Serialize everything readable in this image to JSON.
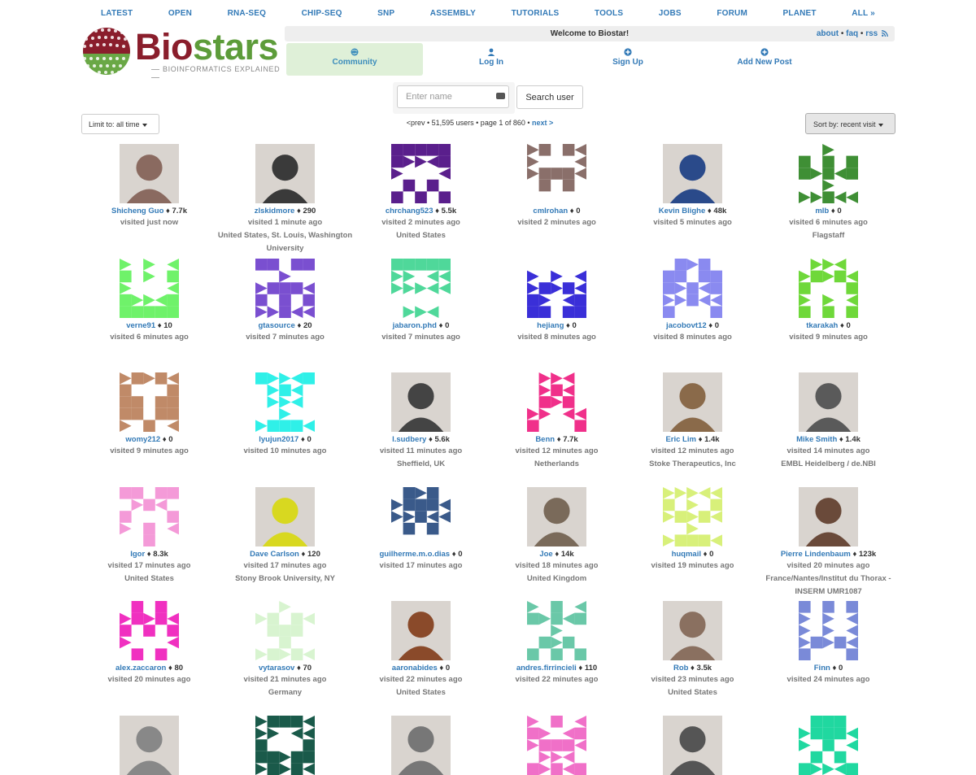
{
  "nav": [
    "LATEST",
    "OPEN",
    "RNA-SEQ",
    "CHIP-SEQ",
    "SNP",
    "ASSEMBLY",
    "TUTORIALS",
    "TOOLS",
    "JOBS",
    "FORUM",
    "PLANET",
    "ALL »"
  ],
  "logo": {
    "word1": "Bio",
    "word2": "stars",
    "tagline": "BIOINFORMATICS EXPLAINED"
  },
  "welcome": {
    "text": "Welcome to Biostar!",
    "about": "about",
    "faq": "faq",
    "rss": "rss",
    "sep": "•"
  },
  "menu": [
    {
      "label": "Community",
      "icon": "globe-icon"
    },
    {
      "label": "Log In",
      "icon": "user-icon"
    },
    {
      "label": "Sign Up",
      "icon": "plus-icon"
    },
    {
      "label": "Add New Post",
      "icon": "plus-icon"
    }
  ],
  "search": {
    "placeholder": "Enter name",
    "button": "Search user"
  },
  "limit": "Limit to: all time",
  "sort": "Sort by: recent visit",
  "pager": {
    "prev": "<prev",
    "summary": "• 51,595 users • page 1 of 860 •",
    "next": "next >"
  },
  "colors": {
    "link": "#337ab7",
    "active_tab_bg": "#dff0d8",
    "logo_red": "#8a1e2c",
    "logo_green": "#5d9c3a"
  },
  "users": [
    {
      "name": "Shicheng Guo",
      "rep": "7.7k",
      "visited": "visited just now",
      "loc": "",
      "color": "#8a6a60",
      "photo": true
    },
    {
      "name": "zlskidmore",
      "rep": "290",
      "visited": "visited 1 minute ago",
      "loc": "United States, St. Louis, Washington University",
      "color": "#3a3a3a",
      "photo": true
    },
    {
      "name": "chrchang523",
      "rep": "5.5k",
      "visited": "visited 2 minutes ago",
      "loc": "United States",
      "color": "#5a1f8c",
      "photo": false
    },
    {
      "name": "cmlrohan",
      "rep": "0",
      "visited": "visited 2 minutes ago",
      "loc": "",
      "color": "#8a6f6a",
      "photo": false
    },
    {
      "name": "Kevin Blighe",
      "rep": "48k",
      "visited": "visited 5 minutes ago",
      "loc": "",
      "color": "#2a4a8a",
      "photo": true
    },
    {
      "name": "mlb",
      "rep": "0",
      "visited": "visited 6 minutes ago",
      "loc": "Flagstaff",
      "color": "#3f8f35",
      "photo": false
    },
    {
      "name": "verne91",
      "rep": "10",
      "visited": "visited 6 minutes ago",
      "loc": "",
      "color": "#6ff26a",
      "photo": false
    },
    {
      "name": "gtasource",
      "rep": "20",
      "visited": "visited 7 minutes ago",
      "loc": "",
      "color": "#7a4fd0",
      "photo": false
    },
    {
      "name": "jabaron.phd",
      "rep": "0",
      "visited": "visited 7 minutes ago",
      "loc": "",
      "color": "#4fd89a",
      "photo": false
    },
    {
      "name": "hejiang",
      "rep": "0",
      "visited": "visited 8 minutes ago",
      "loc": "",
      "color": "#3a2fd8",
      "photo": false
    },
    {
      "name": "jacobovt12",
      "rep": "0",
      "visited": "visited 8 minutes ago",
      "loc": "",
      "color": "#8a8af0",
      "photo": false
    },
    {
      "name": "tkarakah",
      "rep": "0",
      "visited": "visited 9 minutes ago",
      "loc": "",
      "color": "#6fd83a",
      "photo": false
    },
    {
      "name": "womy212",
      "rep": "0",
      "visited": "visited 9 minutes ago",
      "loc": "",
      "color": "#c08a68",
      "photo": false
    },
    {
      "name": "lyujun2017",
      "rep": "0",
      "visited": "visited 10 minutes ago",
      "loc": "",
      "color": "#2ff0e8",
      "photo": false
    },
    {
      "name": "l.sudbery",
      "rep": "5.6k",
      "visited": "visited 11 minutes ago",
      "loc": "Sheffield, UK",
      "color": "#444444",
      "photo": true
    },
    {
      "name": "Benn",
      "rep": "7.7k",
      "visited": "visited 12 minutes ago",
      "loc": "Netherlands",
      "color": "#f0308a",
      "photo": false
    },
    {
      "name": "Eric Lim",
      "rep": "1.4k",
      "visited": "visited 12 minutes ago",
      "loc": "Stoke Therapeutics, Inc",
      "color": "#8a6a4a",
      "photo": true
    },
    {
      "name": "Mike Smith",
      "rep": "1.4k",
      "visited": "visited 14 minutes ago",
      "loc": "EMBL Heidelberg / de.NBI",
      "color": "#5a5a5a",
      "photo": true
    },
    {
      "name": "Igor",
      "rep": "8.3k",
      "visited": "visited 17 minutes ago",
      "loc": "United States",
      "color": "#f49ad8",
      "photo": false
    },
    {
      "name": "Dave Carlson",
      "rep": "120",
      "visited": "visited 17 minutes ago",
      "loc": "Stony Brook University, NY",
      "color": "#d8d820",
      "photo": true
    },
    {
      "name": "guilherme.m.o.dias",
      "rep": "0",
      "visited": "visited 17 minutes ago",
      "loc": "",
      "color": "#3a5a8a",
      "photo": false
    },
    {
      "name": "Joe",
      "rep": "14k",
      "visited": "visited 18 minutes ago",
      "loc": "United Kingdom",
      "color": "#7a6a5a",
      "photo": true
    },
    {
      "name": "huqmail",
      "rep": "0",
      "visited": "visited 19 minutes ago",
      "loc": "",
      "color": "#d8f07a",
      "photo": false
    },
    {
      "name": "Pierre Lindenbaum",
      "rep": "123k",
      "visited": "visited 20 minutes ago",
      "loc": "France/Nantes/Institut du Thorax - INSERM UMR1087",
      "color": "#6a4a3a",
      "photo": true
    },
    {
      "name": "alex.zaccaron",
      "rep": "80",
      "visited": "visited 20 minutes ago",
      "loc": "",
      "color": "#f030c0",
      "photo": false
    },
    {
      "name": "vytarasov",
      "rep": "70",
      "visited": "visited 21 minutes ago",
      "loc": "Germany",
      "color": "#d8f4d0",
      "photo": false
    },
    {
      "name": "aaronabides",
      "rep": "0",
      "visited": "visited 22 minutes ago",
      "loc": "United States",
      "color": "#8a4a2a",
      "photo": true
    },
    {
      "name": "andres.firrincieli",
      "rep": "110",
      "visited": "visited 22 minutes ago",
      "loc": "",
      "color": "#6ac8a8",
      "photo": false
    },
    {
      "name": "Rob",
      "rep": "3.5k",
      "visited": "visited 23 minutes ago",
      "loc": "United States",
      "color": "#8a7060",
      "photo": true
    },
    {
      "name": "Finn",
      "rep": "0",
      "visited": "visited 24 minutes ago",
      "loc": "",
      "color": "#7a8ad8",
      "photo": false
    },
    {
      "name": "",
      "rep": "",
      "visited": "",
      "loc": "",
      "color": "#888888",
      "photo": true
    },
    {
      "name": "",
      "rep": "",
      "visited": "",
      "loc": "",
      "color": "#1a5a4a",
      "photo": false
    },
    {
      "name": "",
      "rep": "",
      "visited": "",
      "loc": "",
      "color": "#777777",
      "photo": true
    },
    {
      "name": "",
      "rep": "",
      "visited": "",
      "loc": "",
      "color": "#f070c8",
      "photo": false
    },
    {
      "name": "",
      "rep": "",
      "visited": "",
      "loc": "",
      "color": "#555555",
      "photo": true
    },
    {
      "name": "",
      "rep": "",
      "visited": "",
      "loc": "",
      "color": "#20d8a0",
      "photo": false
    }
  ]
}
